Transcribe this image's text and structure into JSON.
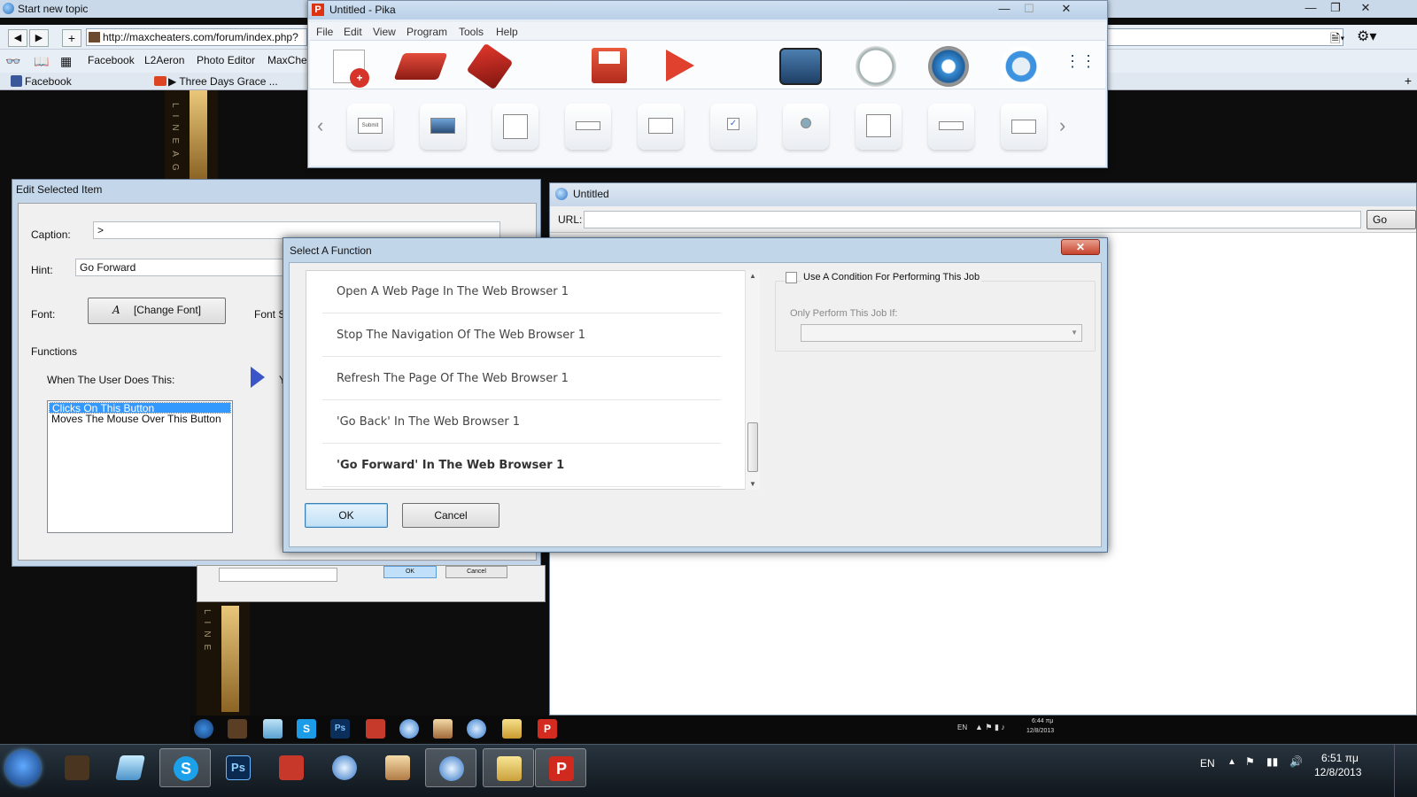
{
  "browser": {
    "tab_title": "Start new topic",
    "url": "http://maxcheaters.com/forum/index.php?",
    "bookmarks": [
      "Facebook",
      "L2Aeron",
      "Photo Editor",
      "MaxChe"
    ],
    "tabs": [
      "Facebook",
      "▶ Three Days Grace ..."
    ]
  },
  "pika": {
    "title": "Untitled - Pika",
    "logo_letter": "P",
    "menu": [
      "File",
      "Edit",
      "View",
      "Program",
      "Tools",
      "Help"
    ],
    "submit_caption": "Submit"
  },
  "edit_item": {
    "title": "Edit Selected Item",
    "caption_label": "Caption:",
    "caption_value": ">",
    "hint_label": "Hint:",
    "hint_value": "Go Forward",
    "font_label": "Font:",
    "change_font_label": "[Change Font]",
    "font_size_label": "Font Si",
    "functions_label": "Functions",
    "when_user_label": "When The User Does This:",
    "you_label": "Y",
    "events": [
      {
        "label": "Clicks On This Button",
        "selected": true
      },
      {
        "label": "Moves The Mouse Over This Button",
        "selected": false
      }
    ],
    "ok_label": "OK",
    "cancel_label": "Cancel"
  },
  "preview": {
    "title": "Untitled",
    "url_label": "URL:",
    "go_label": "Go"
  },
  "select_function": {
    "title": "Select A Function",
    "close_label": "✕",
    "items": [
      {
        "label": "Open A Web Page In The Web Browser 1",
        "bold": false
      },
      {
        "label": "Stop The Navigation Of The Web Browser 1",
        "bold": false
      },
      {
        "label": "Refresh The Page Of The Web Browser 1",
        "bold": false
      },
      {
        "label": "'Go Back' In The Web Browser 1",
        "bold": false
      },
      {
        "label": "'Go Forward' In The Web Browser 1",
        "bold": true
      }
    ],
    "condition_label": "Use A Condition For Performing This Job",
    "only_if_label": "Only Perform This Job If:",
    "ok_label": "OK",
    "cancel_label": "Cancel"
  },
  "mini_tray": {
    "lang": "EN",
    "time": "6:44 πμ",
    "date": "12/8/2013"
  },
  "taskbar": {
    "lang": "EN",
    "time": "6:51 πμ",
    "date": "12/8/2013"
  },
  "colors": {
    "selection": "#3399ff",
    "window_frame": "#c2d6ea",
    "taskbar": "#1c2630"
  }
}
